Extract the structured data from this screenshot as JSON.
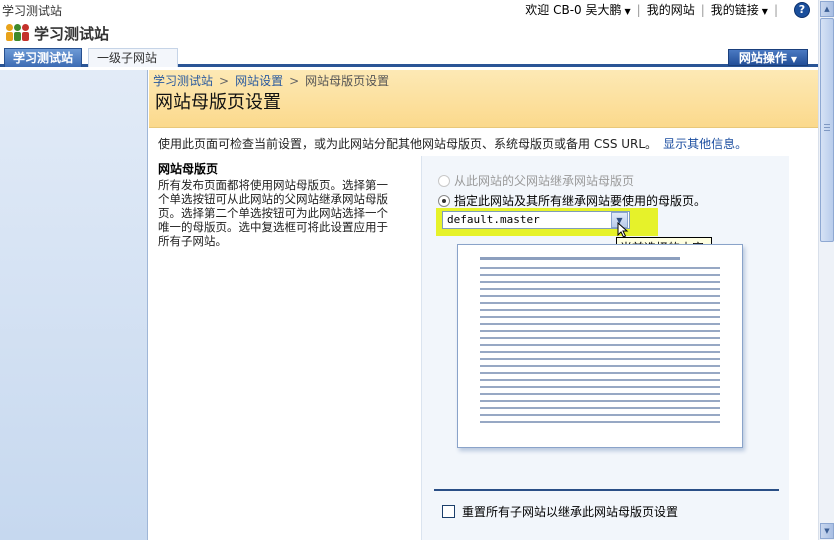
{
  "topbar": {
    "site_name": "学习测试站",
    "welcome": "欢迎 CB-0 吴大鹏",
    "my_site": "我的网站",
    "my_links": "我的链接",
    "help_label": "?"
  },
  "titlebar": {
    "title": "学习测试站"
  },
  "tabs": [
    {
      "label": "学习测试站",
      "active": true
    },
    {
      "label": "一级子网站",
      "active": false
    }
  ],
  "site_actions": "网站操作",
  "breadcrumb": {
    "items": [
      "学习测试站",
      "网站设置",
      "网站母版页设置"
    ],
    "separator": ">"
  },
  "page_title": "网站母版页设置",
  "description": {
    "text": "使用此页面可检查当前设置，或为此网站分配其他网站母版页、系统母版页或备用 CSS URL。",
    "link": "显示其他信息。"
  },
  "section": {
    "heading": "网站母版页",
    "body": "所有发布页面都将使用网站母版页。选择第一个单选按钮可从此网站的父网站继承网站母版页。选择第二个单选按钮可为此网站选择一个唯一的母版页。选中复选框可将此设置应用于所有子网站。"
  },
  "options": {
    "inherit_label": "从此网站的父网站继承网站母版页",
    "specify_label": "指定此网站及其所有继承网站要使用的母版页。",
    "selected_master": "default.master",
    "tooltip": "当前选择的内容:"
  },
  "reset_checkbox_label": "重置所有子网站以继承此网站母版页设置",
  "colors": {
    "accent": "#2a5596",
    "highlight": "#e6f22a",
    "header_bg": "#fbd98c",
    "link": "#1c4ea0"
  }
}
